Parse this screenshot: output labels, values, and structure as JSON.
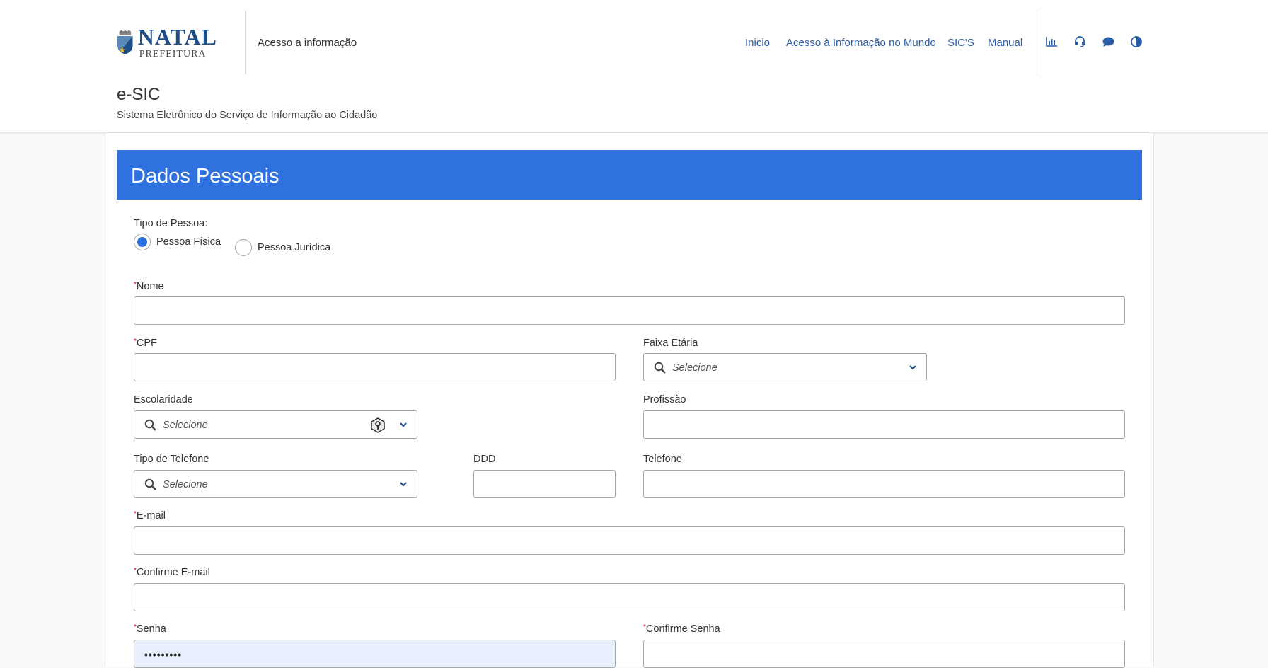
{
  "header": {
    "logo": {
      "main": "NATAL",
      "sub": "PREFEITURA"
    },
    "site_name": "Acesso a informação",
    "nav": [
      "Inicio",
      "Acesso à Informação no Mundo",
      "SIC'S",
      "Manual"
    ],
    "tools": [
      "bar-chart-icon",
      "headset-icon",
      "chat-bubble-icon",
      "contrast-icon"
    ],
    "app_title": "e-SIC",
    "app_subtitle": "Sistema Eletrônico do Serviço de Informação ao Cidadão"
  },
  "form": {
    "title": "Dados Pessoais",
    "person_type": {
      "label": "Tipo de Pessoa:",
      "options": [
        "Pessoa Física",
        "Pessoa Jurídica"
      ],
      "selected": "Pessoa Física"
    },
    "required_marker": "*",
    "fields": {
      "nome": {
        "label": "Nome",
        "value": ""
      },
      "cpf": {
        "label": "CPF",
        "value": ""
      },
      "faixa_etaria": {
        "label": "Faixa Etária",
        "placeholder": "Selecione"
      },
      "escolaridade": {
        "label": "Escolaridade",
        "placeholder": "Selecione"
      },
      "profissao": {
        "label": "Profissão",
        "value": ""
      },
      "tipo_telefone": {
        "label": "Tipo de Telefone",
        "placeholder": "Selecione"
      },
      "ddd": {
        "label": "DDD",
        "value": ""
      },
      "telefone": {
        "label": "Telefone",
        "value": ""
      },
      "email": {
        "label": "E-mail",
        "value": ""
      },
      "confirme_email": {
        "label": "Confirme E-mail",
        "value": ""
      },
      "senha": {
        "label": "Senha",
        "value": "•••••••••"
      },
      "confirme_senha": {
        "label": "Confirme Senha",
        "value": ""
      }
    }
  },
  "colors": {
    "banner": "#2f71de",
    "link": "#2a5fa7",
    "required": "#d0021b",
    "autofill": "#e8f0fe"
  }
}
